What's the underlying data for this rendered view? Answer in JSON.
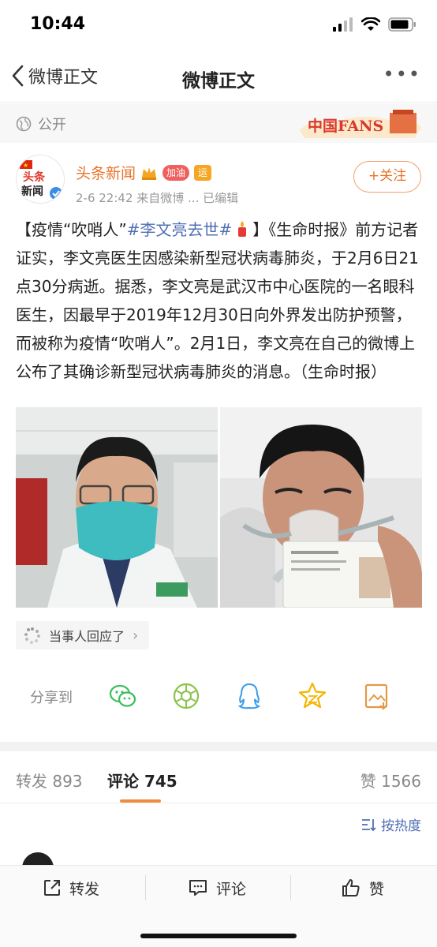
{
  "status_bar": {
    "time": "10:44"
  },
  "nav": {
    "back_label": "微博正文",
    "title": "微博正文",
    "more": "•••"
  },
  "visibility": {
    "label": "公开"
  },
  "banner": {
    "text": "中国FANS"
  },
  "author": {
    "name": "头条新闻",
    "avatar_text_top": "头条",
    "avatar_text_bottom": "新闻",
    "badge_fan": "加油",
    "badge_service": "运",
    "meta": "2-6 22:42  来自微博 ... 已编辑",
    "follow_label": "+关注"
  },
  "post": {
    "part1": "【疫情“吹哨人”",
    "hashtag": "#李文亮去世#",
    "part2": "】《生命时报》前方记者证实，李文亮医生因感染新型冠状病毒肺炎，于2月6日21点30分病逝。据悉，李文亮是武汉市中心医院的一名眼科医生，因最早于2019年12月30日向外界发出防护预警，而被称为疫情“吹哨人”。2月1日，李文亮在自己的微博上公布了其确诊新型冠状病毒肺炎的消息。（生命时报）"
  },
  "related": {
    "label": "当事人回应了",
    "chevron": "›"
  },
  "share": {
    "label": "分享到",
    "targets": [
      "wechat-icon",
      "moments-icon",
      "qq-icon",
      "qzone-icon",
      "save-image-icon"
    ]
  },
  "tabs": {
    "repost_label": "转发",
    "repost_count": "893",
    "comment_label": "评论",
    "comment_count": "745",
    "like_label": "赞",
    "like_count": "1566"
  },
  "sort": {
    "label": "按热度"
  },
  "toolbar": {
    "repost": "转发",
    "comment": "评论",
    "like": "赞"
  },
  "colors": {
    "accent_orange": "#e8742a",
    "link_blue": "#506fb5",
    "tab_underline": "#f08c3c"
  }
}
